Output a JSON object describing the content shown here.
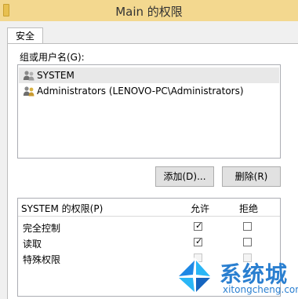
{
  "window": {
    "title": "Main 的权限"
  },
  "tabs": [
    {
      "label": "安全"
    }
  ],
  "groups": {
    "label": "组或用户名(G):",
    "items": [
      {
        "label": "SYSTEM",
        "selected": true
      },
      {
        "label": "Administrators (LENOVO-PC\\Administrators)",
        "selected": false
      }
    ]
  },
  "buttons": {
    "add_label": "添加(D)...",
    "remove_label": "删除(R)"
  },
  "permissions": {
    "header_label": "SYSTEM 的权限(P)",
    "allow_label": "允许",
    "deny_label": "拒绝",
    "rows": [
      {
        "name": "完全控制",
        "allow": true,
        "deny": false,
        "disabled": false
      },
      {
        "name": "读取",
        "allow": true,
        "deny": false,
        "disabled": false
      },
      {
        "name": "特殊权限",
        "allow": false,
        "deny": false,
        "disabled": true
      }
    ]
  },
  "watermark": {
    "cn": "系统城",
    "en": "xitongcheng.com"
  }
}
